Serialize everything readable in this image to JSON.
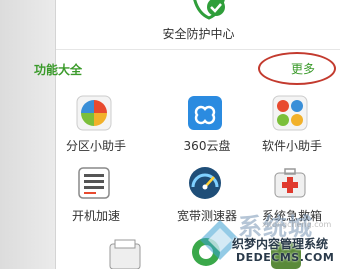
{
  "security": {
    "label": "安全防护中心"
  },
  "section": {
    "title": "功能大全",
    "more": "更多"
  },
  "tiles": [
    {
      "label": "分区小助手",
      "icon": "pie-chart-icon"
    },
    {
      "label": "360云盘",
      "icon": "cloud-icon"
    },
    {
      "label": "软件小助手",
      "icon": "app-grid-icon"
    },
    {
      "label": "开机加速",
      "icon": "boot-icon"
    },
    {
      "label": "宽带测速器",
      "icon": "speedometer-icon"
    },
    {
      "label": "系统急救箱",
      "icon": "first-aid-icon"
    }
  ],
  "watermark": {
    "brand": "系统城",
    "small": "xitongcheng.com",
    "site": "织梦内容管理系统",
    "domain": "DEDECMS.COM"
  },
  "colors": {
    "accent": "#3a9a2a",
    "highlight_oval": "#c33a2e"
  }
}
